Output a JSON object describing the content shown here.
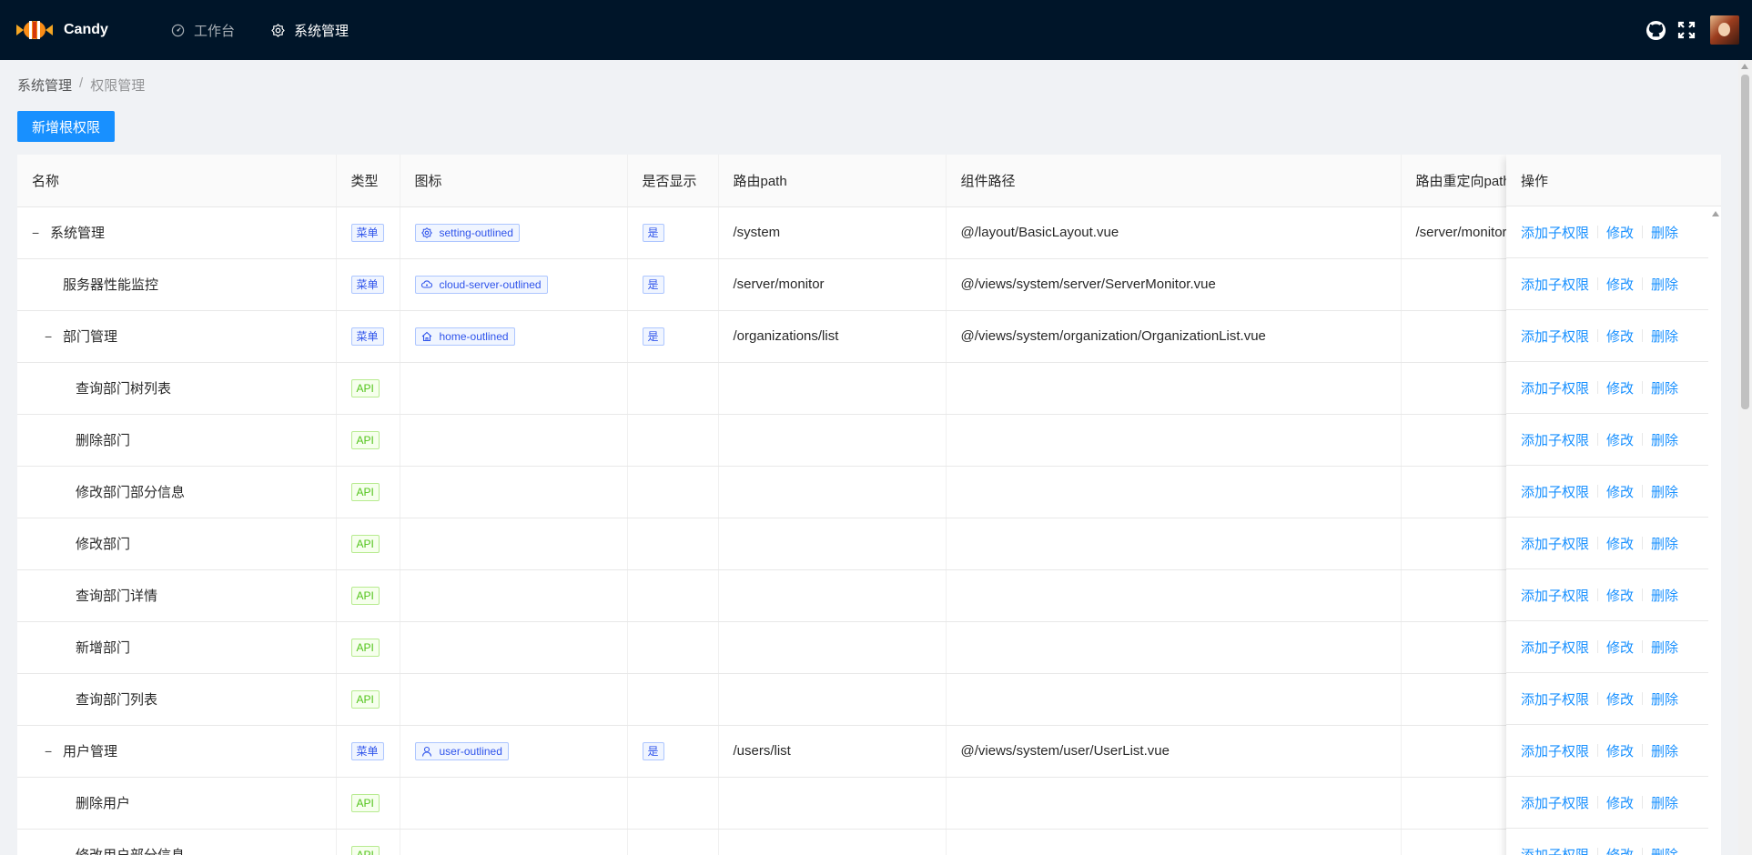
{
  "header": {
    "app_name": "Candy",
    "nav": [
      {
        "label": "工作台",
        "icon": "dashboard-icon"
      },
      {
        "label": "系统管理",
        "icon": "setting-icon"
      }
    ],
    "right_icons": [
      "github-icon",
      "fullscreen-icon",
      "avatar"
    ]
  },
  "breadcrumb": {
    "parent": "系统管理",
    "separator": "/",
    "current": "权限管理"
  },
  "actions": {
    "add_root": "新增根权限"
  },
  "table": {
    "columns": [
      "名称",
      "类型",
      "图标",
      "是否显示",
      "路由path",
      "组件路径",
      "路由重定向path",
      "操作"
    ],
    "op_labels": {
      "add_child": "添加子权限",
      "edit": "修改",
      "delete": "删除"
    },
    "rows": [
      {
        "name": "系统管理",
        "level": 0,
        "expandable": true,
        "type": "菜单",
        "icon": "setting-outlined",
        "show": "是",
        "path": "/system",
        "component": "@/layout/BasicLayout.vue",
        "redirect": "/server/monitor"
      },
      {
        "name": "服务器性能监控",
        "level": 1,
        "expandable": false,
        "type": "菜单",
        "icon": "cloud-server-outlined",
        "show": "是",
        "path": "/server/monitor",
        "component": "@/views/system/server/ServerMonitor.vue",
        "redirect": ""
      },
      {
        "name": "部门管理",
        "level": 1,
        "expandable": true,
        "type": "菜单",
        "icon": "home-outlined",
        "show": "是",
        "path": "/organizations/list",
        "component": "@/views/system/organization/OrganizationList.vue",
        "redirect": ""
      },
      {
        "name": "查询部门树列表",
        "level": 2,
        "expandable": false,
        "type": "API",
        "icon": "",
        "show": "",
        "path": "",
        "component": "",
        "redirect": ""
      },
      {
        "name": "删除部门",
        "level": 2,
        "expandable": false,
        "type": "API",
        "icon": "",
        "show": "",
        "path": "",
        "component": "",
        "redirect": ""
      },
      {
        "name": "修改部门部分信息",
        "level": 2,
        "expandable": false,
        "type": "API",
        "icon": "",
        "show": "",
        "path": "",
        "component": "",
        "redirect": ""
      },
      {
        "name": "修改部门",
        "level": 2,
        "expandable": false,
        "type": "API",
        "icon": "",
        "show": "",
        "path": "",
        "component": "",
        "redirect": ""
      },
      {
        "name": "查询部门详情",
        "level": 2,
        "expandable": false,
        "type": "API",
        "icon": "",
        "show": "",
        "path": "",
        "component": "",
        "redirect": ""
      },
      {
        "name": "新增部门",
        "level": 2,
        "expandable": false,
        "type": "API",
        "icon": "",
        "show": "",
        "path": "",
        "component": "",
        "redirect": ""
      },
      {
        "name": "查询部门列表",
        "level": 2,
        "expandable": false,
        "type": "API",
        "icon": "",
        "show": "",
        "path": "",
        "component": "",
        "redirect": ""
      },
      {
        "name": "用户管理",
        "level": 1,
        "expandable": true,
        "type": "菜单",
        "icon": "user-outlined",
        "show": "是",
        "path": "/users/list",
        "component": "@/views/system/user/UserList.vue",
        "redirect": ""
      },
      {
        "name": "删除用户",
        "level": 2,
        "expandable": false,
        "type": "API",
        "icon": "",
        "show": "",
        "path": "",
        "component": "",
        "redirect": ""
      },
      {
        "name": "修改用户部分信息",
        "level": 2,
        "expandable": false,
        "type": "API",
        "icon": "",
        "show": "",
        "path": "",
        "component": "",
        "redirect": ""
      }
    ]
  },
  "colors": {
    "header_bg": "#001529",
    "primary": "#1890ff",
    "menu_tag": "#2f54eb",
    "api_tag": "#52c41a"
  }
}
